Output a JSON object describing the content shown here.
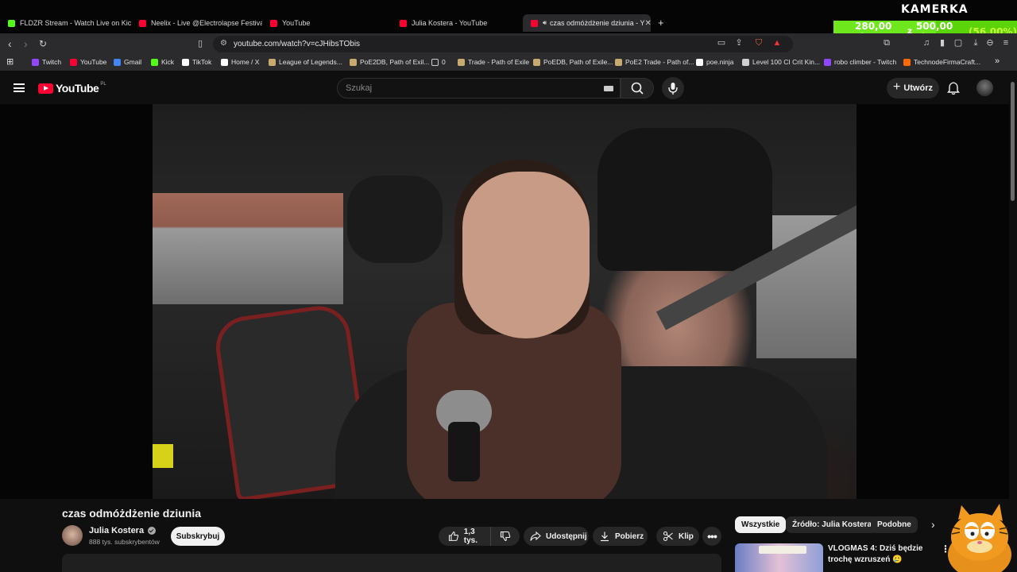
{
  "browser": {
    "tabs": [
      {
        "title": "FLDZR Stream - Watch Live on Kick",
        "favicon": "kick-icon"
      },
      {
        "title": "Neelix - Live @Electrolapse Festival 2",
        "favicon": "youtube-icon"
      },
      {
        "title": "YouTube",
        "favicon": "youtube-icon"
      },
      {
        "title": "Julia Kostera - YouTube",
        "favicon": "youtube-icon"
      },
      {
        "title": "czas odmóżdżenie dziunia - Y",
        "favicon": "youtube-icon",
        "active": true
      }
    ],
    "new_tab": "+",
    "url": "youtube.com/watch?v=cJHibsTObis",
    "bookmarks": [
      {
        "label": "Twitch",
        "color": "#9146ff"
      },
      {
        "label": "YouTube",
        "color": "#ff0033"
      },
      {
        "label": "Gmail",
        "color": "#4285f4"
      },
      {
        "label": "Kick",
        "color": "#53fc18"
      },
      {
        "label": "TikTok",
        "color": "#ffffff"
      },
      {
        "label": "Home / X",
        "color": "#ffffff"
      },
      {
        "label": "League of Legends...",
        "color": "#c8aa6e"
      },
      {
        "label": "PoE2DB, Path of Exil...",
        "color": "#c8aa6e"
      },
      {
        "label": "0",
        "color": "#cfcfcf"
      },
      {
        "label": "Trade - Path of Exile",
        "color": "#c8aa6e"
      },
      {
        "label": "PoEDB, Path of Exile...",
        "color": "#c8aa6e"
      },
      {
        "label": "PoE2 Trade - Path of...",
        "color": "#c8aa6e"
      },
      {
        "label": "poe.ninja",
        "color": "#ffffff"
      },
      {
        "label": "Level 100 CI Crit Kin...",
        "color": "#cfcfcf"
      },
      {
        "label": "robo climber - Twitch",
        "color": "#9146ff"
      },
      {
        "label": "TechnodeFirmaCraft...",
        "color": "#ff6a00"
      }
    ],
    "bookmarks_more": "»"
  },
  "overlay": {
    "kamerka": "KAMERKA",
    "goal_current": "280,00 zł",
    "goal_of": "z",
    "goal_target": "500,00 zł",
    "goal_percent": "(56.00%)",
    "goal_fraction": 0.56
  },
  "youtube": {
    "logo_text": "YouTube",
    "country_code": "PL",
    "search_placeholder": "Szukaj",
    "create_label": "Utwórz",
    "video": {
      "title": "czas odmóżdżenie dziunia",
      "channel": "Julia Kostera",
      "subscribers": "888 tys. subskrybentów",
      "subscribe_label": "Subskrybuj",
      "likes": "1,3 tys.",
      "share_label": "Udostępnij",
      "download_label": "Pobierz",
      "clip_label": "Klip"
    },
    "chips": [
      "Wszystkie",
      "Źródło: Julia Kostera",
      "Podobne"
    ],
    "recommended": [
      {
        "title": "VLOGMAS 4: Dziś będzie trochę wzruszeń 🥲"
      }
    ]
  }
}
